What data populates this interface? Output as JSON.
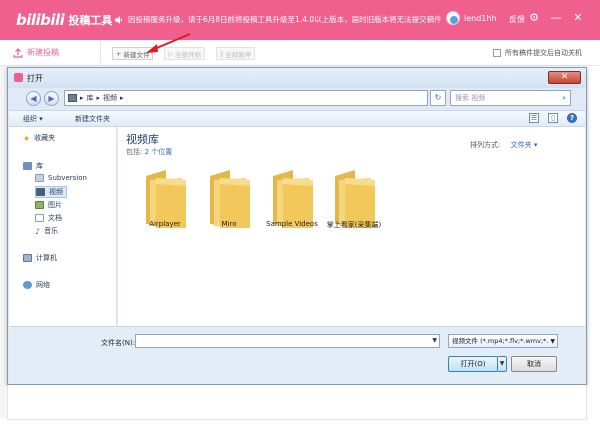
{
  "app": {
    "logo_mark": "bilibili",
    "logo_text": "投稿工具",
    "notice": "因投稿服务升级，请于6月8日前将投稿工具升级至1.4.0以上版本，届时旧版本将无法提交稿件",
    "username": "lend1hh",
    "feedback": "反馈"
  },
  "subbar": {
    "new_upload": "新建投稿",
    "btn_new_file": "新建文件",
    "btn_start_all": "全部开始",
    "btn_pause_all": "全部暂停",
    "auto_shutdown": "所有稿件提交后自动关机"
  },
  "dialog": {
    "title": "打开",
    "close": "✕",
    "breadcrumb": [
      "库",
      "视频"
    ],
    "search_placeholder": "搜索 视频",
    "cmd_organize": "组织 ▾",
    "cmd_new_folder": "新建文件夹",
    "nav": {
      "favorites": "收藏夹",
      "library": "库",
      "subversion": "Subversion",
      "videos": "视频",
      "pictures": "图片",
      "documents": "文档",
      "music": "音乐",
      "computer": "计算机",
      "network": "网络"
    },
    "library_title": "视频库",
    "library_includes_label": "包括:",
    "library_includes_value": "2 个位置",
    "arrange_label": "排列方式:",
    "arrange_value": "文件夹 ▾",
    "folders": [
      "Airplayer",
      "Miro",
      "Sample Videos",
      "掌上看家(采集端)"
    ],
    "filename_label": "文件名(N):",
    "filetype": "视频文件 (*.mp4;*.flv;*.wmv;*.",
    "open_btn": "打开(O)",
    "cancel_btn": "取消"
  },
  "colors": {
    "brand_pink": "#f0608f",
    "folder_yellow": "#f2c85b"
  }
}
